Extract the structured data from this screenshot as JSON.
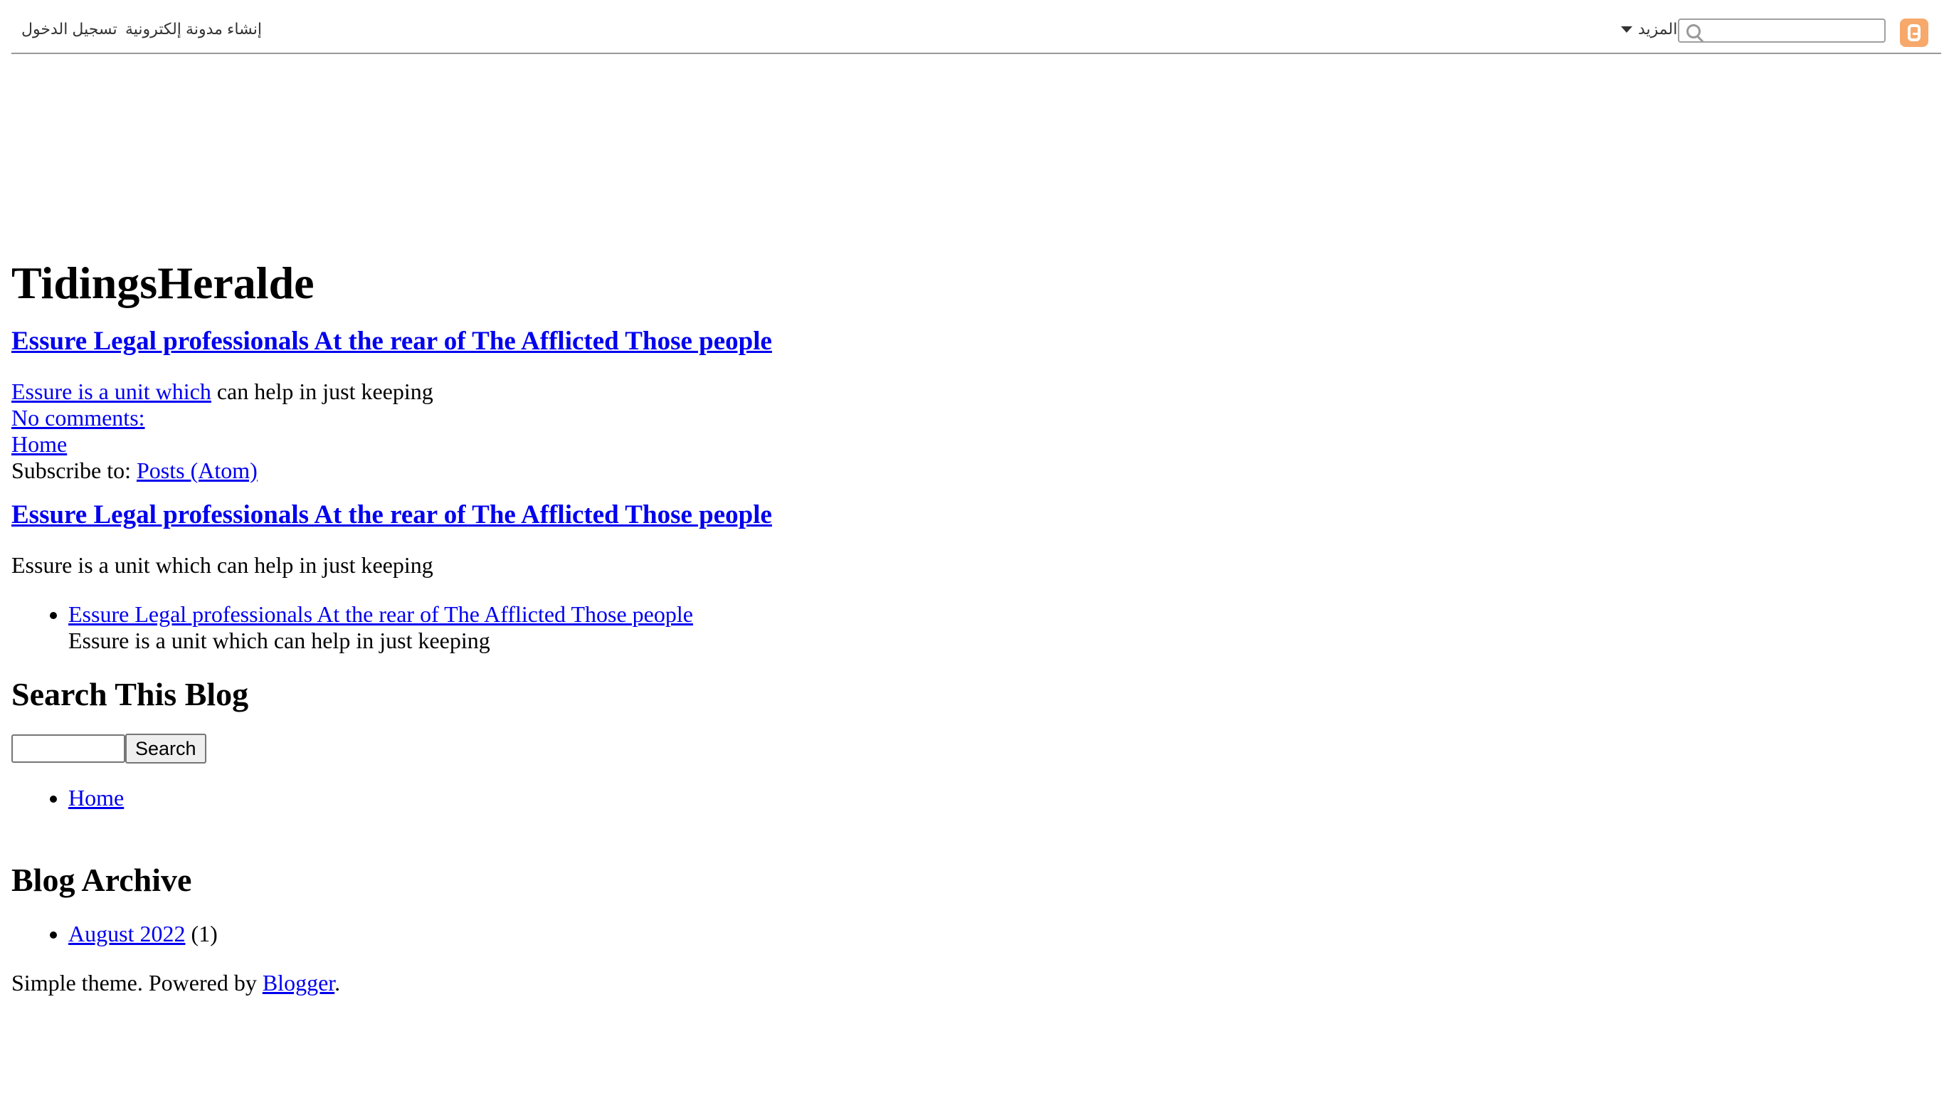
{
  "navbar": {
    "login": "تسجيل الدخول",
    "create_blog": "إنشاء مدونة إلكترونية",
    "more": "المزيد",
    "search_placeholder": ""
  },
  "blog": {
    "title": "TidingsHeralde"
  },
  "post1": {
    "title": "Essure Legal professionals At the rear of The Afflicted Those people",
    "snippet_link": "Essure is a unit which",
    "snippet_rest": " can help in just keeping",
    "comments": "No comments:"
  },
  "nav": {
    "home": "Home",
    "subscribe_prefix": "Subscribe to: ",
    "subscribe_link": "Posts (Atom)"
  },
  "post2": {
    "title": "Essure Legal professionals At the rear of The Afflicted Those people",
    "snippet": "Essure is a unit which can help in just keeping"
  },
  "popular": {
    "items": [
      {
        "title": "Essure Legal professionals At the rear of The Afflicted Those people",
        "snippet": "Essure is a unit which can help in just keeping"
      }
    ]
  },
  "search_widget": {
    "heading": "Search This Blog",
    "button": "Search"
  },
  "pages": {
    "home": "Home"
  },
  "archive": {
    "heading": "Blog Archive",
    "month": "August 2022",
    "count": " (1)"
  },
  "footer": {
    "prefix": "Simple theme. Powered by ",
    "link": "Blogger",
    "suffix": "."
  }
}
